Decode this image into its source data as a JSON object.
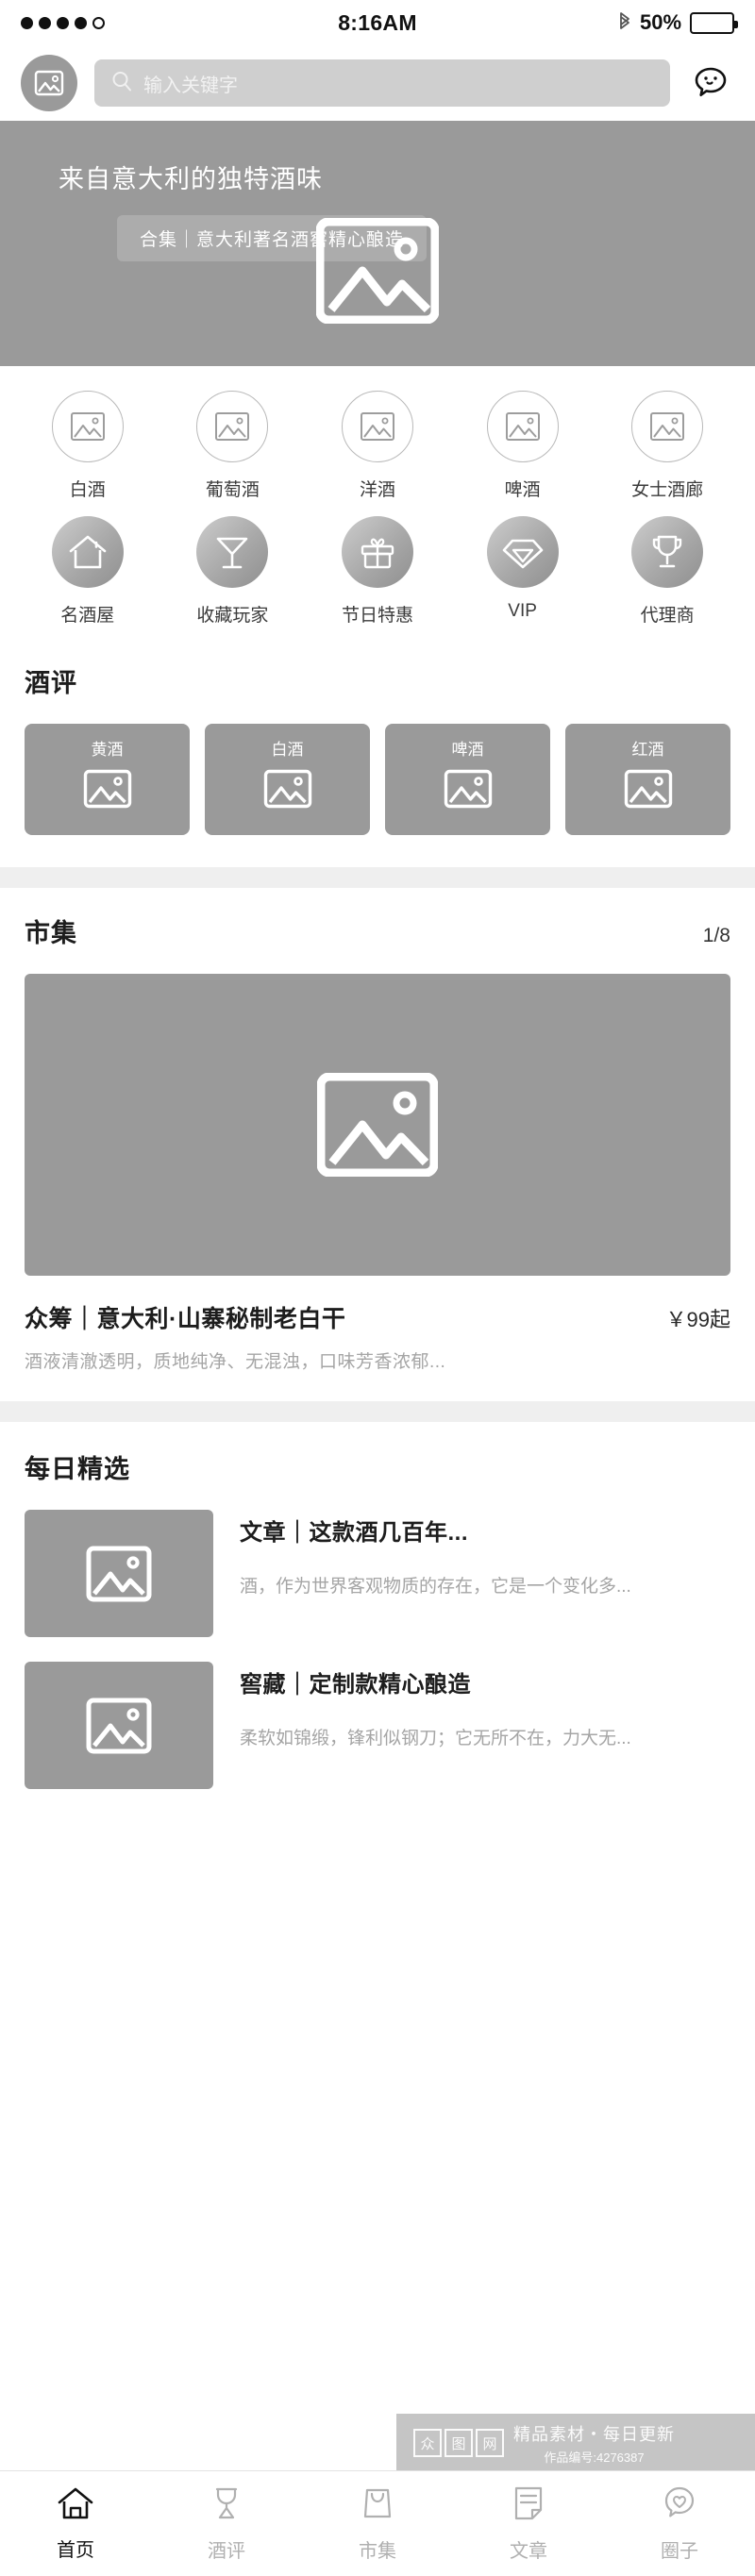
{
  "status_bar": {
    "signal_dots_filled": 4,
    "signal_dots_total": 5,
    "time": "8:16AM",
    "bluetooth_icon": "bluetooth-icon",
    "battery_percent_label": "50%",
    "battery_level": 50
  },
  "header": {
    "avatar_icon": "image-placeholder-icon",
    "search_placeholder": "输入关键字",
    "search_value": "",
    "search_icon": "search-icon",
    "chat_icon": "chat-smiley-icon"
  },
  "hero": {
    "title": "来自意大利的独特酒味",
    "tag": "合集｜意大利著名酒窖精心酿造",
    "placeholder_icon": "image-placeholder-icon",
    "background_color": "#9a9a9a"
  },
  "categories": {
    "row1": [
      {
        "label": "白酒",
        "icon": "image-placeholder-icon"
      },
      {
        "label": "葡萄酒",
        "icon": "image-placeholder-icon"
      },
      {
        "label": "洋酒",
        "icon": "image-placeholder-icon"
      },
      {
        "label": "啤酒",
        "icon": "image-placeholder-icon"
      },
      {
        "label": "女士酒廊",
        "icon": "image-placeholder-icon"
      }
    ],
    "row2": [
      {
        "label": "名酒屋",
        "icon": "house-icon"
      },
      {
        "label": "收藏玩家",
        "icon": "cocktail-glass-icon"
      },
      {
        "label": "节日特惠",
        "icon": "gift-icon"
      },
      {
        "label": "VIP",
        "icon": "diamond-icon"
      },
      {
        "label": "代理商",
        "icon": "trophy-icon"
      }
    ]
  },
  "reviews": {
    "title": "酒评",
    "cards": [
      {
        "label": "黄酒",
        "icon": "image-placeholder-icon"
      },
      {
        "label": "白酒",
        "icon": "image-placeholder-icon"
      },
      {
        "label": "啤酒",
        "icon": "image-placeholder-icon"
      },
      {
        "label": "红酒",
        "icon": "image-placeholder-icon"
      }
    ]
  },
  "market": {
    "title": "市集",
    "counter": "1/8",
    "image_icon": "image-placeholder-icon",
    "product_title": "众筹｜意大利·山寨秘制老白干",
    "product_price": "￥99起",
    "product_desc": "酒液清澈透明，质地纯净、无混浊，口味芳香浓郁..."
  },
  "daily": {
    "title": "每日精选",
    "articles": [
      {
        "title": "文章｜这款酒几百年...",
        "desc": "酒，作为世界客观物质的存在，它是一个变化多...",
        "thumb_icon": "image-placeholder-icon"
      },
      {
        "title": "窖藏｜定制款精心酿造",
        "desc": "柔软如锦缎，锋利似钢刀；它无所不在，力大无...",
        "thumb_icon": "image-placeholder-icon"
      }
    ]
  },
  "watermark": {
    "logo_chars": [
      "众",
      "图",
      "网"
    ],
    "tagline": "精品素材・每日更新",
    "work_id": "作品编号:4276387"
  },
  "bottom_nav": {
    "items": [
      {
        "label": "首页",
        "icon": "home-icon",
        "active": true
      },
      {
        "label": "酒评",
        "icon": "wine-glass-icon",
        "active": false
      },
      {
        "label": "市集",
        "icon": "shopping-bag-icon",
        "active": false
      },
      {
        "label": "文章",
        "icon": "document-icon",
        "active": false
      },
      {
        "label": "圈子",
        "icon": "heart-bubble-icon",
        "active": false
      }
    ]
  }
}
